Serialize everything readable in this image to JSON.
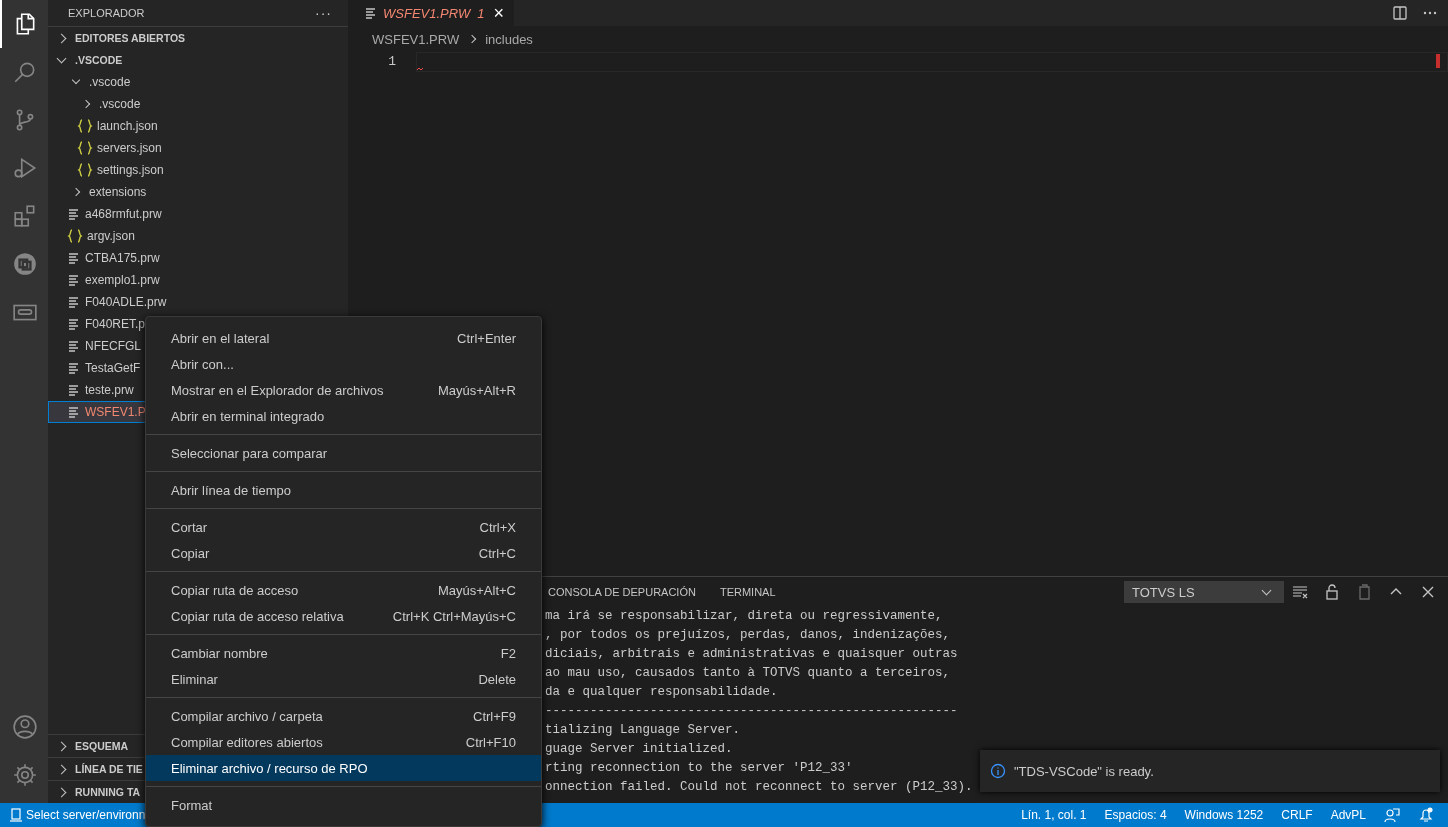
{
  "activity_bar": {
    "items": [
      {
        "kind": "explorer",
        "selected": true
      },
      {
        "kind": "search",
        "selected": false
      },
      {
        "kind": "source-control",
        "selected": false
      },
      {
        "kind": "run",
        "selected": false
      },
      {
        "kind": "extensions",
        "selected": false
      },
      {
        "kind": "totvs",
        "selected": false
      },
      {
        "kind": "monitor",
        "selected": false
      }
    ],
    "bottom": [
      {
        "kind": "account"
      },
      {
        "kind": "settings"
      }
    ]
  },
  "sidebar": {
    "title": "EXPLORADOR",
    "more": "···",
    "open_editors": {
      "label": "EDITORES ABIERTOS",
      "expanded": false
    },
    "folder": {
      "label": ".VSCODE",
      "expanded": true,
      "children": [
        {
          "name": ".vscode",
          "kind": "folder",
          "expanded": true,
          "selected": false,
          "error": false,
          "children": [
            {
              "name": ".vscode",
              "kind": "folder",
              "expanded": false,
              "selected": false,
              "error": false
            },
            {
              "name": "launch.json",
              "kind": "json",
              "selected": false,
              "error": false
            },
            {
              "name": "servers.json",
              "kind": "json",
              "selected": false,
              "error": false
            },
            {
              "name": "settings.json",
              "kind": "json",
              "selected": false,
              "error": false
            }
          ]
        },
        {
          "name": "extensions",
          "kind": "folder",
          "expanded": false,
          "selected": false,
          "error": false
        },
        {
          "name": "a468rmfut.prw",
          "kind": "file",
          "selected": false,
          "error": false
        },
        {
          "name": "argv.json",
          "kind": "json",
          "selected": false,
          "error": false
        },
        {
          "name": "CTBA175.prw",
          "kind": "file",
          "selected": false,
          "error": false
        },
        {
          "name": "exemplo1.prw",
          "kind": "file",
          "selected": false,
          "error": false
        },
        {
          "name": "F040ADLE.prw",
          "kind": "file",
          "selected": false,
          "error": false
        },
        {
          "name": "F040RET.p",
          "kind": "file",
          "selected": false,
          "error": false
        },
        {
          "name": "NFECFGL",
          "kind": "file",
          "selected": false,
          "error": false
        },
        {
          "name": "TestaGetF",
          "kind": "file",
          "selected": false,
          "error": false
        },
        {
          "name": "teste.prw",
          "kind": "file",
          "selected": false,
          "error": false
        },
        {
          "name": "WSFEV1.P",
          "kind": "file",
          "selected": true,
          "error": true
        }
      ]
    },
    "sections": [
      {
        "label": "ESQUEMA",
        "expanded": false
      },
      {
        "label": "LÍNEA DE TIE",
        "expanded": false
      },
      {
        "label": "RUNNING TA",
        "expanded": false
      }
    ]
  },
  "editor": {
    "tab": {
      "label": "WSFEV1.PRW",
      "problems": "1",
      "close": "×",
      "error": true,
      "preview": true
    },
    "breadcrumb": [
      "WSFEV1.PRW",
      "includes"
    ],
    "line_numbers": [
      "1"
    ]
  },
  "panel": {
    "tabs": [
      {
        "label": "CONSOLA DE DEPURACIÓN",
        "selected": false
      },
      {
        "label": "TERMINAL",
        "selected": false
      }
    ],
    "output_select": "TOTVS LS",
    "lines": [
      "ma irá se responsabilizar, direta ou regressivamente,",
      ", por todos os prejuízos, perdas, danos, indenizações,",
      "diciais, arbitrais e administrativas e quaisquer outras",
      "ao mau uso, causados tanto à TOTVS quanto a terceiros,",
      "da e qualquer responsabilidade.",
      "-------------------------------------------------------",
      "tializing Language Server.",
      "guage Server initialized.",
      "rting reconnection to the server 'P12_33'",
      "onnection failed. Could not reconnect to server (P12_33)."
    ]
  },
  "context_menu": {
    "groups": [
      [
        {
          "label": "Abrir en el lateral",
          "shortcut": "Ctrl+Enter",
          "selected": false
        },
        {
          "label": "Abrir con...",
          "selected": false
        },
        {
          "label": "Mostrar en el Explorador de archivos",
          "shortcut": "Mayús+Alt+R",
          "selected": false
        },
        {
          "label": "Abrir en terminal integrado",
          "selected": false
        }
      ],
      [
        {
          "label": "Seleccionar para comparar",
          "selected": false
        }
      ],
      [
        {
          "label": "Abrir línea de tiempo",
          "selected": false
        }
      ],
      [
        {
          "label": "Cortar",
          "shortcut": "Ctrl+X",
          "selected": false
        },
        {
          "label": "Copiar",
          "shortcut": "Ctrl+C",
          "selected": false
        }
      ],
      [
        {
          "label": "Copiar ruta de acceso",
          "shortcut": "Mayús+Alt+C",
          "selected": false
        },
        {
          "label": "Copiar ruta de acceso relativa",
          "shortcut": "Ctrl+K Ctrl+Mayús+C",
          "selected": false
        }
      ],
      [
        {
          "label": "Cambiar nombre",
          "shortcut": "F2",
          "selected": false
        },
        {
          "label": "Eliminar",
          "shortcut": "Delete",
          "selected": false
        }
      ],
      [
        {
          "label": "Compilar archivo / carpeta",
          "shortcut": "Ctrl+F9",
          "selected": false
        },
        {
          "label": "Compilar editores abiertos",
          "shortcut": "Ctrl+F10",
          "selected": false
        },
        {
          "label": "Eliminar archivo / recurso de RPO",
          "selected": true
        }
      ],
      [
        {
          "label": "Format",
          "selected": false
        }
      ]
    ]
  },
  "notification": {
    "message": "\"TDS-VSCode\" is ready."
  },
  "status_bar": {
    "left": "Select server/environn",
    "right": [
      "Lín. 1, col. 1",
      "Espacios: 4",
      "Windows 1252",
      "CRLF",
      "AdvPL"
    ]
  }
}
